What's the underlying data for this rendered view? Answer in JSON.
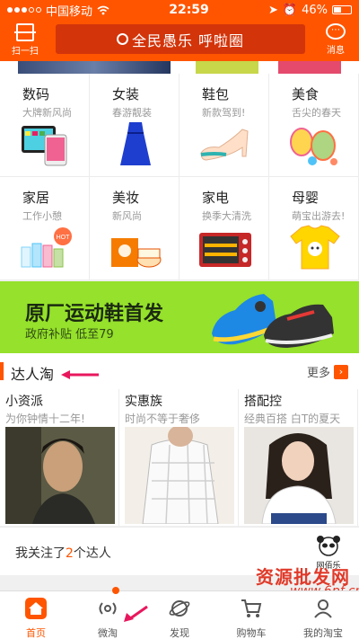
{
  "status": {
    "carrier": "中国移动",
    "time": "22:59",
    "battery": "46%"
  },
  "header": {
    "scan_label": "扫一扫",
    "search_text": "全民愚乐 呼啦圈",
    "message_label": "消息"
  },
  "categories": [
    {
      "title": "数码",
      "subtitle": "大牌新风尚"
    },
    {
      "title": "女装",
      "subtitle": "春游靓装"
    },
    {
      "title": "鞋包",
      "subtitle": "新款驾到!"
    },
    {
      "title": "美食",
      "subtitle": "舌尖的春天"
    },
    {
      "title": "家居",
      "subtitle": "工作小憩"
    },
    {
      "title": "美妆",
      "subtitle": "新风尚"
    },
    {
      "title": "家电",
      "subtitle": "换季大清洗"
    },
    {
      "title": "母婴",
      "subtitle": "萌宝出游去!"
    }
  ],
  "hot_badge": "HOT",
  "promo": {
    "headline": "原厂运动鞋首发",
    "subline": "政府补贴 低至79"
  },
  "section": {
    "title": "达人淘",
    "more": "更多"
  },
  "talents": [
    {
      "name": "小资派",
      "desc": "为你钟情十二年!"
    },
    {
      "name": "实惠族",
      "desc": "时尚不等于奢侈"
    },
    {
      "name": "搭配控",
      "desc": "经典百搭 白T的夏天"
    }
  ],
  "follow": {
    "prefix": "我关注了",
    "count": "2",
    "suffix": "个达人",
    "logo_text": "网佰乐"
  },
  "tabs": [
    {
      "label": "首页"
    },
    {
      "label": "微淘"
    },
    {
      "label": "发现"
    },
    {
      "label": "购物车"
    },
    {
      "label": "我的淘宝"
    }
  ],
  "watermark": {
    "line1": "资源批发网",
    "line2": "www.6pf.cn"
  },
  "colors": {
    "brand": "#ff5500",
    "promo_bg": "#95e12b"
  }
}
